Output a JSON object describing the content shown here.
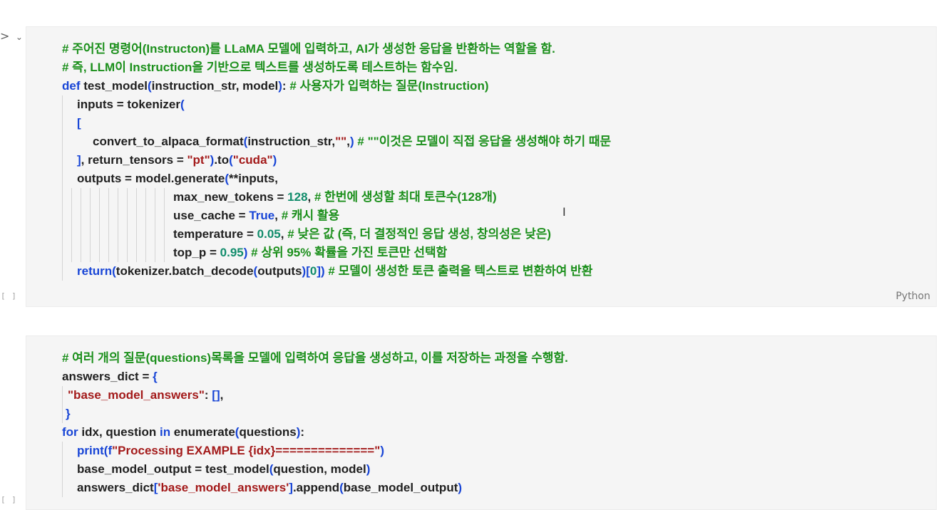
{
  "cell1": {
    "execution_count": "[ ]",
    "language": "Python",
    "lines": [
      "# 주어진 명령어(Instructon)를 LLaMA 모델에 입력하고, AI가 생성한 응답을 반환하는 역할을 함.",
      "# 즉, LLM이 Instruction을 기반으로 텍스트를 생성하도록 테스트하는 함수임.",
      "def test_model(instruction_str, model): # 사용자가 입력하는 질문(Instruction)",
      "inputs = tokenizer(",
      "[",
      "convert_to_alpaca_format(instruction_str,\"\",) # \"\"이것은 모델이 직접 응답을 생성해야 하기 때문",
      "], return_tensors = \"pt\").to(\"cuda\")",
      "outputs = model.generate(**inputs,",
      "max_new_tokens = 128, # 한번에 생성할 최대 토큰수(128개)",
      "use_cache = True, # 캐시 활용",
      "temperature = 0.05, # 낮은 값 (즉, 더 결정적인 응답 생성, 창의성은 낮은)",
      "top_p = 0.95) # 상위 95% 확률을 가진 토큰만 선택함",
      "return(tokenizer.batch_decode(outputs)[0]) # 모델이 생성한 토큰 출력을 텍스트로 변환하여 반환"
    ]
  },
  "cell2": {
    "execution_count": "[ ]",
    "lines": [
      "# 여러 개의 질문(questions)목록을 모델에 입력하여 응답을 생성하고, 이를 저장하는 과정을 수행함.",
      "answers_dict = {",
      "\"base_model_answers\": [],",
      "}",
      "for idx, question in enumerate(questions):",
      "print(f\"Processing EXAMPLE {idx}==============\")",
      "base_model_output = test_model(question, model)",
      "answers_dict['base_model_answers'].append(base_model_output)"
    ]
  },
  "toolbar": {
    "run_icon": ">",
    "collapse_icon": "⌄"
  },
  "colors": {
    "comment": "#1b8f1b",
    "keyword": "#1845d6",
    "string": "#a31a1a",
    "number": "#118c6b"
  }
}
